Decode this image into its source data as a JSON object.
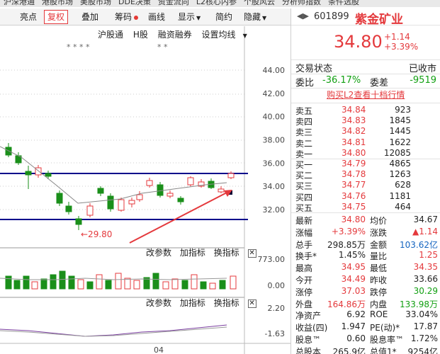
{
  "topmenu": [
    "沪深港通",
    "港股市场",
    "美股市场",
    "DDE决策",
    "资金流向",
    "L2核心内参",
    "个股风云",
    "分析师指数",
    "条件选股"
  ],
  "toolbar": {
    "items": [
      {
        "label": "亮点",
        "dot": false,
        "active": false
      },
      {
        "label": "复权",
        "dot": false,
        "active": true
      },
      {
        "label": "叠加",
        "dot": false,
        "active": false
      },
      {
        "label": "筹码",
        "dot": true,
        "active": false
      },
      {
        "label": "画线",
        "dot": false,
        "active": false
      },
      {
        "label": "显示",
        "dot": false,
        "active": false
      },
      {
        "label": "简约",
        "dot": false,
        "active": false
      },
      {
        "label": "隐藏",
        "dot": false,
        "active": false
      }
    ]
  },
  "chart": {
    "sub_links": [
      "沪股通",
      "H股",
      "融资融券",
      "设置均线"
    ],
    "star_marks": [
      "* * * *",
      "* *"
    ],
    "price_axis": [
      "44.00",
      "42.00",
      "40.00",
      "38.00",
      "36.00",
      "34.00",
      "32.00"
    ],
    "low_marker": "←29.80",
    "volume_tools": [
      "改参数",
      "加指标",
      "换指标"
    ],
    "volume_axis": [
      "773.00",
      "0.00"
    ],
    "macd_tools": [
      "改参数",
      "加指标",
      "换指标"
    ],
    "macd_axis": [
      "2.20",
      "-1.63"
    ],
    "date_label": "04",
    "candle_colors": {
      "up": "#e4393c",
      "down": "#1a8f1a"
    },
    "line_colors": {
      "band": "#00008b",
      "arrow": "#e4393c"
    }
  },
  "stock": {
    "code": "601899",
    "name": "紫金矿业",
    "price": "34.80",
    "change": "+1.14",
    "change_pct": "+3.39%",
    "trade_status_label": "交易状态",
    "trade_status": "已收市",
    "weibi_label": "委比",
    "weibi": "-36.17%",
    "weicha_label": "委差",
    "weicha": "-9519",
    "l2_link": "购买L2查看十档行情"
  },
  "sells": [
    {
      "label": "卖五",
      "price": "34.84",
      "vol": "923"
    },
    {
      "label": "卖四",
      "price": "34.83",
      "vol": "1845"
    },
    {
      "label": "卖三",
      "price": "34.82",
      "vol": "1445"
    },
    {
      "label": "卖二",
      "price": "34.81",
      "vol": "1622"
    },
    {
      "label": "卖一",
      "price": "34.80",
      "vol": "12085"
    }
  ],
  "buys": [
    {
      "label": "买一",
      "price": "34.79",
      "vol": "4865"
    },
    {
      "label": "买二",
      "price": "34.78",
      "vol": "1263"
    },
    {
      "label": "买三",
      "price": "34.77",
      "vol": "628"
    },
    {
      "label": "买四",
      "price": "34.76",
      "vol": "1181"
    },
    {
      "label": "买五",
      "price": "34.75",
      "vol": "464"
    }
  ],
  "stats": [
    [
      {
        "label": "最新",
        "value": "34.80",
        "color": "red"
      },
      {
        "label": "均价",
        "value": "34.67",
        "color": "dark"
      }
    ],
    [
      {
        "label": "涨幅",
        "value": "+3.39%",
        "color": "red"
      },
      {
        "label": "涨跌",
        "value": "▲1.14",
        "color": "red"
      }
    ],
    [
      {
        "label": "总手",
        "value": "298.85万",
        "color": "dark"
      },
      {
        "label": "金额",
        "value": "103.62亿",
        "color": "blue"
      }
    ],
    [
      {
        "label": "换手*",
        "value": "1.45%",
        "color": "dark"
      },
      {
        "label": "量比",
        "value": "1.25",
        "color": "red"
      }
    ],
    [
      {
        "label": "最高",
        "value": "34.95",
        "color": "red"
      },
      {
        "label": "最低",
        "value": "34.35",
        "color": "red"
      }
    ],
    [
      {
        "label": "今开",
        "value": "34.49",
        "color": "red"
      },
      {
        "label": "昨收",
        "value": "33.66",
        "color": "dark"
      }
    ],
    [
      {
        "label": "涨停",
        "value": "37.03",
        "color": "red"
      },
      {
        "label": "跌停",
        "value": "30.29",
        "color": "green"
      }
    ],
    [
      {
        "label": "外盘",
        "value": "164.86万",
        "color": "red"
      },
      {
        "label": "内盘",
        "value": "133.98万",
        "color": "green"
      }
    ],
    [
      {
        "label": "净资产",
        "value": "6.92",
        "color": "dark"
      },
      {
        "label": "ROE",
        "value": "33.04%",
        "color": "dark"
      }
    ],
    [
      {
        "label": "收益(四)",
        "value": "1.947",
        "color": "dark"
      },
      {
        "label": "PE(动)*",
        "value": "17.87",
        "color": "dark"
      }
    ],
    [
      {
        "label": "股息™",
        "value": "0.60",
        "color": "dark"
      },
      {
        "label": "股息率™",
        "value": "1.72%",
        "color": "dark"
      }
    ],
    [
      {
        "label": "总股本",
        "value": "265.9亿",
        "color": "dark"
      },
      {
        "label": "总值1*",
        "value": "9254亿",
        "color": "dark"
      }
    ]
  ]
}
